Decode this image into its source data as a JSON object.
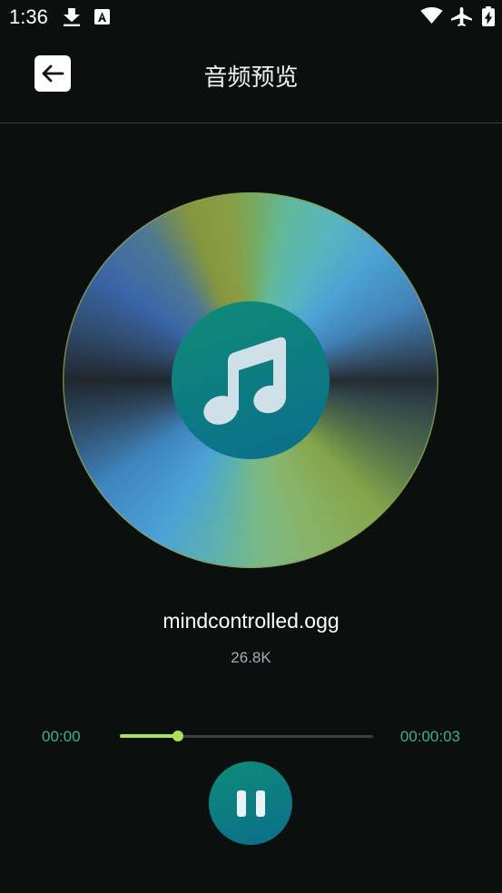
{
  "status_bar": {
    "time": "1:36",
    "left_icons": [
      "download-icon",
      "text-a-icon"
    ],
    "right_icons": [
      "wifi-icon",
      "airplane-mode-icon",
      "battery-charging-icon"
    ]
  },
  "header": {
    "back_icon": "arrow-left-icon",
    "title": "音频预览"
  },
  "disc": {
    "center_icon": "music-note-icon"
  },
  "file": {
    "name": "mindcontrolled.ogg",
    "size": "26.8K"
  },
  "playback": {
    "current_time": "00:00",
    "total_time": "00:00:03",
    "progress_fraction": 0.23,
    "control_icon": "pause-icon"
  },
  "colors": {
    "background": "#0b0f0d",
    "accent": "#a6e35a",
    "time_text": "#44ad8b",
    "secondary_text": "#a9aab8",
    "button_gradient_start": "#0f8c76",
    "button_gradient_end": "#0b6d8d",
    "icon_light": "#cfe1e7",
    "track": "#3b3f40"
  }
}
